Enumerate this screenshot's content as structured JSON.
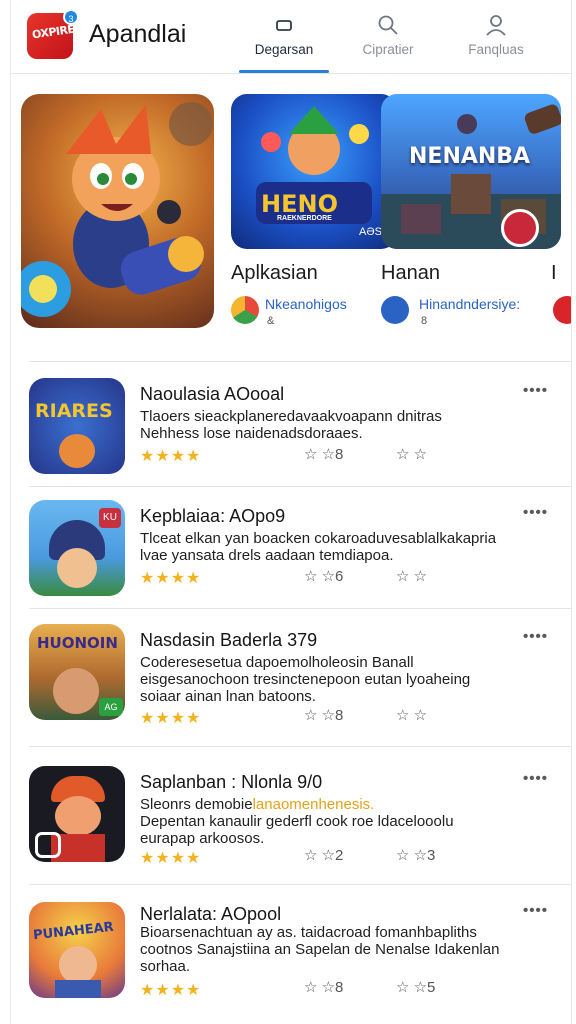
{
  "header": {
    "logo_text": "OXPIRE",
    "logo_badge": "3",
    "app_title": "Apandlai",
    "tabs": [
      {
        "label": "Degarsan",
        "icon": "rectangle-icon",
        "active": true
      },
      {
        "label": "Cipratier",
        "icon": "search-icon",
        "active": false
      },
      {
        "label": "Fanqluas",
        "icon": "person-icon",
        "active": false
      }
    ]
  },
  "featured": {
    "tiles": [
      {
        "tile_title": "HENO",
        "tile_subtitle": "RAEKNERDORE",
        "tile_count": "AƏS",
        "name": "Aplkasian",
        "developer": "Nkeanohigos",
        "sub": "&"
      },
      {
        "tile_title": "NENANBA",
        "name": "Hanan",
        "developer": "Hinandndersiye:",
        "sub": "8"
      },
      {
        "name": "I"
      }
    ]
  },
  "list": [
    {
      "title": "Naoulasia AOooal",
      "desc": [
        "Tlaoers sieackplaneredavaakvoapann dnitras",
        "Nehhess lose naidenadsdoraaes."
      ],
      "stars": "★★★★",
      "rating1": "☆ ☆8",
      "rating2": "☆ ☆",
      "icon_text": "RIARES"
    },
    {
      "title": "Kepblaiaa: AOpo9",
      "desc": [
        "Tlceat elkan yan boacken cokaroaduvesablalkakapria",
        "lvae yansata drels aadaan temdiapoa."
      ],
      "stars": "★★★★",
      "rating1": "☆ ☆6",
      "rating2": "☆ ☆",
      "icon_text": "KU"
    },
    {
      "title": "Nasdasin Baderla 379",
      "desc": [
        "Coderesesetua dapoemolholeosin Banall",
        "eisgesanochoon tresinctenepoon eutan lyoaheing",
        "soiaar ainan lnan batoons."
      ],
      "stars": "★★★★",
      "rating1": "☆ ☆8",
      "rating2": "☆ ☆",
      "icon_text": "HUONOIN",
      "icon_badge": "AG"
    },
    {
      "title": "Saplanban : Nlonla 9/0",
      "desc_prefix": "Sleonrs demobie",
      "desc_highlight": "lanaomenhenesis.",
      "desc": [
        "Depentan kanaulir gederfl cook roe ldacelooolu",
        "eurapap arkoosos."
      ],
      "stars": "★★★★",
      "rating1": "☆ ☆2",
      "rating2": "☆ ☆3",
      "icon_text": ""
    },
    {
      "title": "Nerlalata: AOpool",
      "desc": [
        "Bioarsenachtuan ay as. taidacroad fomanhbapliths",
        "cootnos Sanajstiina an Sapelan de Nenalse Idakenlan",
        "sorhaa."
      ],
      "stars": "★★★★",
      "rating1": "☆ ☆8",
      "rating2": "☆ ☆5",
      "icon_text": "PUNAHEAR"
    }
  ],
  "more_label": "••••",
  "colors": {
    "accent": "#2a7fd9",
    "star": "#f3b321",
    "logo": "#d9242a",
    "dev_link": "#2b63c4"
  }
}
